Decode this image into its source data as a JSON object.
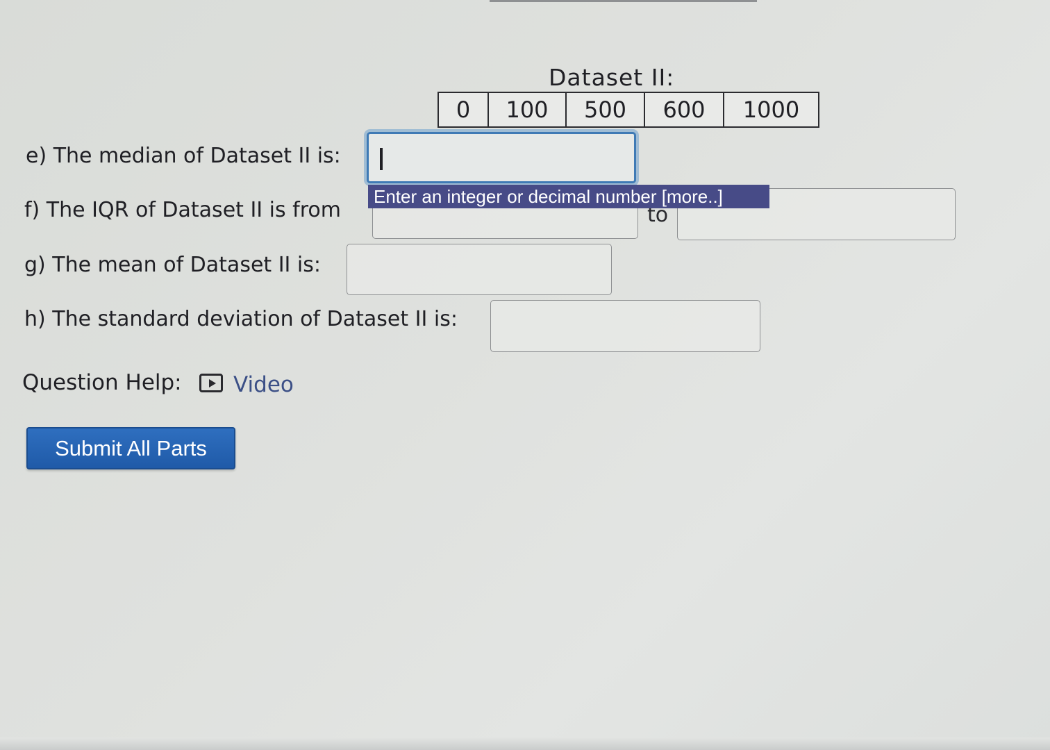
{
  "dataset": {
    "title": "Dataset II:",
    "values": [
      "0",
      "100",
      "500",
      "600",
      "1000"
    ]
  },
  "questions": {
    "e_label": "e) The median of Dataset II is:",
    "f_label": "f) The IQR of Dataset II is from",
    "f_to": "to",
    "g_label": "g) The mean of Dataset II is:",
    "h_label": "h) The standard deviation of Dataset II is:"
  },
  "tooltip": {
    "text": "Enter an integer or decimal number [more..]"
  },
  "help": {
    "label": "Question Help:",
    "video_link": "Video",
    "icon": "play-video-icon"
  },
  "submit": {
    "label": "Submit All Parts"
  },
  "colors": {
    "submit_button": "#2a67b5",
    "tooltip_background": "#474b87",
    "focus_ring": "#3f7ab5",
    "link": "#3b4f86"
  }
}
